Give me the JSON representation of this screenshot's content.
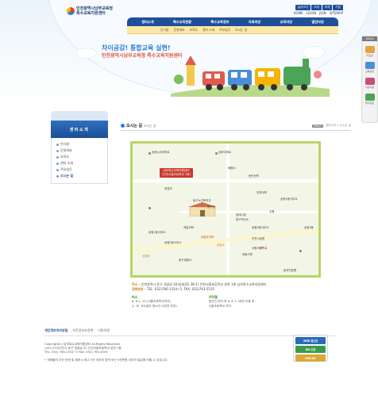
{
  "header": {
    "logo_text_1": "인천광역시남부교육청",
    "logo_text_2": "특수교육지원센터",
    "util_chips": [
      "글자크기",
      "크게",
      "작게",
      "기본"
    ],
    "top_links": [
      "HOME",
      "LOGIN",
      "JOIN",
      "SITEMAP"
    ],
    "gnb": [
      "센터소개",
      "특수교육현황",
      "특수교육정보",
      "자료마당",
      "교육마당",
      "열린마당"
    ],
    "lnb": [
      "인사말",
      "운영개요",
      "조직도",
      "센터 소개",
      "주요업무",
      "오시는 길"
    ],
    "slogan_1": "차이공감! 통합교육 실현!",
    "slogan_2": "인천광역시남부교육청 특수교육지원센터"
  },
  "quick": {
    "title": "QUICK",
    "items": [
      {
        "label": "자료실",
        "color": "#e8a23c"
      },
      {
        "label": "교육상담",
        "color": "#4b8fd6"
      },
      {
        "label": "치료지원",
        "color": "#c44f7a"
      },
      {
        "label": "행사일정",
        "color": "#4ca35a"
      }
    ]
  },
  "sidebar": {
    "heading": "센터소개",
    "items": [
      "인사말",
      "운영개요",
      "조직도",
      "센터 소개",
      "주요업무",
      "오시는 길"
    ],
    "active_index": 5
  },
  "content": {
    "title": "오시는 길",
    "subtitle": "오시는 길",
    "print_chip": "PRINT",
    "breadcrumb": "센터소개 > 오시는 길",
    "map": {
      "pin_line_1": "남부특수교육지원센터",
      "pin_line_2": "(인천서흥초등학교 1층)",
      "labels": [
        "송현누리아파트",
        "삼부아파트",
        "배움소",
        "동인천역",
        "창영초",
        "인하대역",
        "동구노인복지관",
        "동구청",
        "송현1동사무소",
        "송림1동사무소",
        "현대시장",
        "동구보건소",
        "송림2동사무소",
        "제일교회",
        "송림4동사무소",
        "송월동",
        "송림로",
        "수원",
        "동구경찰서",
        "송림3동",
        "인천시농협",
        "서림초등학교",
        "대동이편",
        "송림오거리",
        "동국민은행"
      ],
      "green_color": "#4ca35a",
      "orange_color": "#e07a22"
    },
    "address_label": "주소 :",
    "address": "인천광역시 동구 샛골길 42(송림2동 38-1) 인천서흥초등학교 본관 1층 남부특수교육지원센터",
    "phone_label": "전화번호 :",
    "phone": "TEL. 032)766-1354~5, FAX. 032)763-5535",
    "bus_title": "버스",
    "bus_lines": [
      "6, 6-1, 24 (서흥초등학교하차)",
      "2, 15, 63(동부 청소년 수련관 하차)"
    ],
    "subway_title": "지하철",
    "subway_lines": [
      "동인천 하차 후 6, 6-1, 28번 이용 후",
      "서흥초등학교 하차"
    ]
  },
  "footer": {
    "links": [
      "개인정보처리방침",
      "저작권보호정책",
      "이용약관"
    ],
    "copyright": "Copyright(c) 남부특수교육지원센터 All Rights Reserved",
    "address": "(401-070)인천시 동구 샛골길 42 인천서흥초등학교 본관 1층",
    "contact": "TEL. 032) 766-1354~5 FAX. 032) 763-5535",
    "note": "• 게재물의 무단 전재 및 배포시 최고 5년 이하의 징역 또는 5천만원 이하의 벌금에 처할 수 있습니다.",
    "badges": [
      {
        "label": "WEB 접근성",
        "color": "#2a6bb8"
      },
      {
        "label": "WA 인증",
        "color": "#3b9a4a"
      },
      {
        "label": "KWCAG",
        "color": "#d8a83a"
      }
    ]
  },
  "colors": {
    "primary": "#1f4f9a",
    "accent": "#2a7fd4",
    "map_border": "#b6d566"
  }
}
